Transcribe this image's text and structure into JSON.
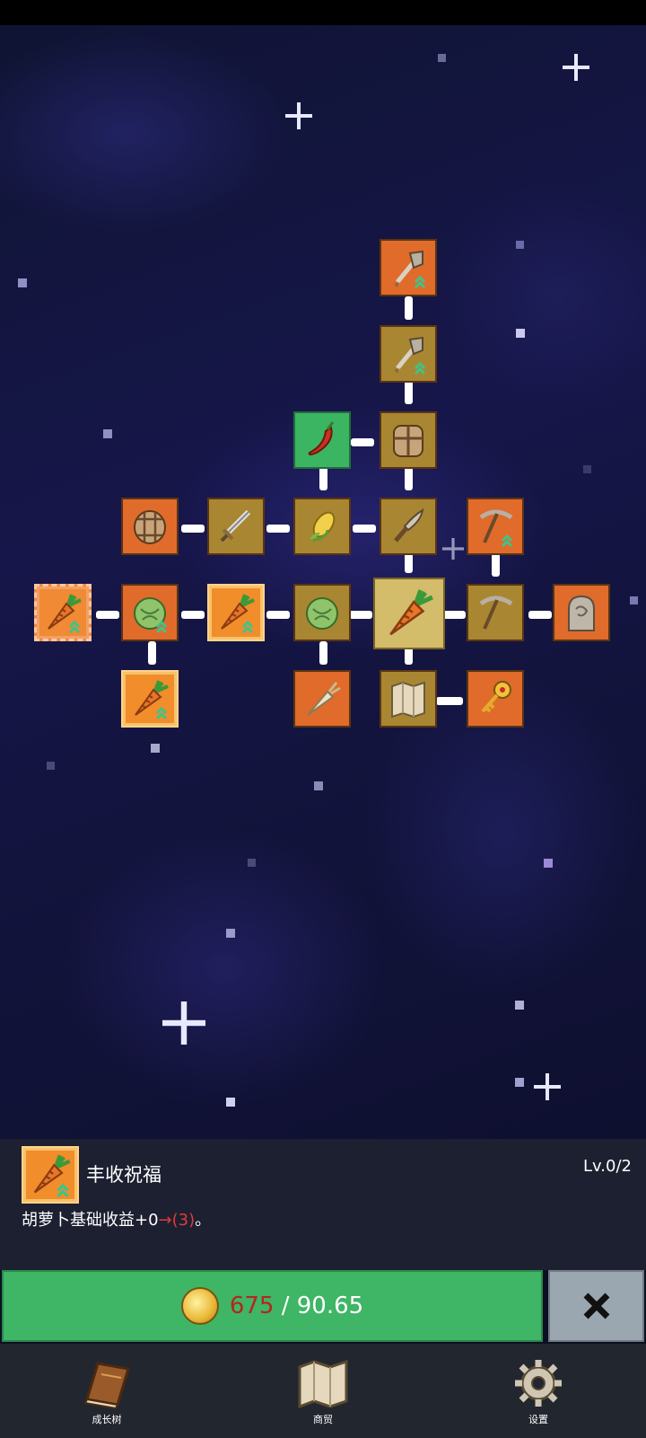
{
  "panel": {
    "title": "丰收祝福",
    "level": "Lv.0/2",
    "desc_text": "胡萝卜基础收益+0",
    "desc_arrow_value": "→(3)",
    "desc_end": "。",
    "icon": "carrot-icon"
  },
  "buy": {
    "cost": "675",
    "separator": "/",
    "balance": "90.65",
    "coin_icon": "coin-icon"
  },
  "close": {
    "icon": "close-x-icon"
  },
  "nav": {
    "items": [
      {
        "label": "成长树",
        "icon": "book-icon"
      },
      {
        "label": "商贸",
        "icon": "map-icon"
      },
      {
        "label": "设置",
        "icon": "gear-icon"
      }
    ]
  },
  "colors": {
    "orange_node": "#e06b2b",
    "brown_node": "#a98632",
    "green_node": "#3bb562",
    "selected_node": "#d3bc6a",
    "buy_button": "#3fb566",
    "cost_text": "#b3261e",
    "close_button": "#9aa7b1"
  },
  "tree": {
    "nodes": [
      {
        "id": "shovel-top",
        "icon": "shovel-icon",
        "state": "orange"
      },
      {
        "id": "shovel-mid",
        "icon": "shovel-icon",
        "state": "brown"
      },
      {
        "id": "chili",
        "icon": "chili-icon",
        "state": "green"
      },
      {
        "id": "backpack-center",
        "icon": "backpack-icon",
        "state": "brown"
      },
      {
        "id": "barrel-left",
        "icon": "barrel-icon",
        "state": "orange"
      },
      {
        "id": "sword",
        "icon": "sword-icon",
        "state": "brown"
      },
      {
        "id": "corn",
        "icon": "corn-icon",
        "state": "brown"
      },
      {
        "id": "knife",
        "icon": "knife-icon",
        "state": "brown"
      },
      {
        "id": "pickaxe-top",
        "icon": "pickaxe-icon",
        "state": "orange"
      },
      {
        "id": "carrot-far-left",
        "icon": "carrot-icon",
        "state": "max"
      },
      {
        "id": "cabbage-left",
        "icon": "cabbage-icon",
        "state": "orange"
      },
      {
        "id": "carrot-left",
        "icon": "carrot-icon",
        "state": "gold"
      },
      {
        "id": "cabbage-mid",
        "icon": "cabbage-icon",
        "state": "brown"
      },
      {
        "id": "carrot-center",
        "icon": "carrot-icon",
        "state": "selected"
      },
      {
        "id": "pickaxe-mid",
        "icon": "pickaxe-icon",
        "state": "brown"
      },
      {
        "id": "ghost",
        "icon": "hooded-figure-icon",
        "state": "orange"
      },
      {
        "id": "carrot-bottom",
        "icon": "carrot-icon",
        "state": "gold"
      },
      {
        "id": "parsnip",
        "icon": "parsnip-icon",
        "state": "orange"
      },
      {
        "id": "map",
        "icon": "map-icon",
        "state": "brown"
      },
      {
        "id": "key",
        "icon": "key-icon",
        "state": "orange"
      }
    ]
  }
}
